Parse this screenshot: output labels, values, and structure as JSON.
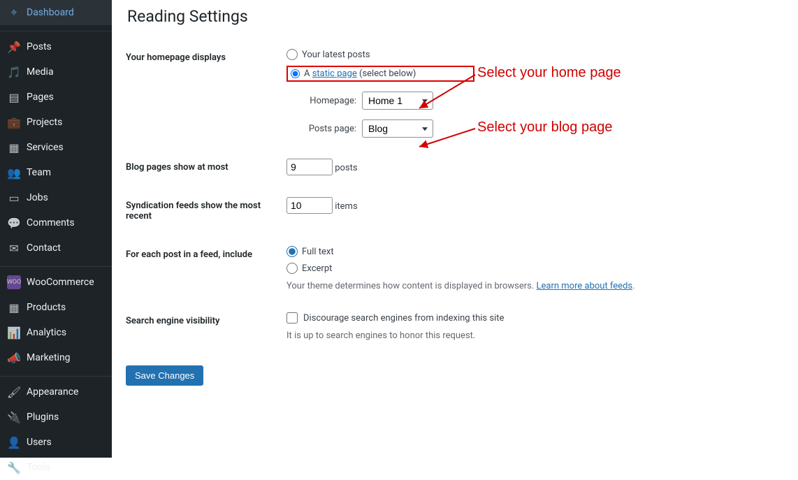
{
  "sidebar": {
    "items": [
      {
        "label": "Dashboard",
        "icon": "dashboard"
      },
      {
        "label": "Posts",
        "icon": "pin"
      },
      {
        "label": "Media",
        "icon": "media"
      },
      {
        "label": "Pages",
        "icon": "pages"
      },
      {
        "label": "Projects",
        "icon": "briefcase"
      },
      {
        "label": "Services",
        "icon": "services"
      },
      {
        "label": "Team",
        "icon": "team"
      },
      {
        "label": "Jobs",
        "icon": "jobs"
      },
      {
        "label": "Comments",
        "icon": "comments"
      },
      {
        "label": "Contact",
        "icon": "contact"
      },
      {
        "label": "WooCommerce",
        "icon": "woo"
      },
      {
        "label": "Products",
        "icon": "products"
      },
      {
        "label": "Analytics",
        "icon": "analytics"
      },
      {
        "label": "Marketing",
        "icon": "marketing"
      },
      {
        "label": "Appearance",
        "icon": "appearance"
      },
      {
        "label": "Plugins",
        "icon": "plugins"
      },
      {
        "label": "Users",
        "icon": "users"
      },
      {
        "label": "Tools",
        "icon": "tools"
      }
    ]
  },
  "page": {
    "title": "Reading Settings"
  },
  "homepage_displays": {
    "label": "Your homepage displays",
    "option_latest": "Your latest posts",
    "option_static_prefix": "A ",
    "option_static_link": "static page",
    "option_static_suffix": " (select below)",
    "homepage_label": "Homepage:",
    "homepage_value": "Home 1",
    "postspage_label": "Posts page:",
    "postspage_value": "Blog"
  },
  "blog_pages": {
    "label": "Blog pages show at most",
    "value": "9",
    "suffix": "posts"
  },
  "syndication": {
    "label": "Syndication feeds show the most recent",
    "value": "10",
    "suffix": "items"
  },
  "feed_include": {
    "label": "For each post in a feed, include",
    "full_text": "Full text",
    "excerpt": "Excerpt",
    "desc_prefix": "Your theme determines how content is displayed in browsers. ",
    "desc_link": "Learn more about feeds"
  },
  "search_visibility": {
    "label": "Search engine visibility",
    "checkbox_label": "Discourage search engines from indexing this site",
    "desc": "It is up to search engines to honor this request."
  },
  "save_button": "Save Changes",
  "annotations": {
    "home": "Select your home page",
    "blog": "Select your blog page"
  }
}
